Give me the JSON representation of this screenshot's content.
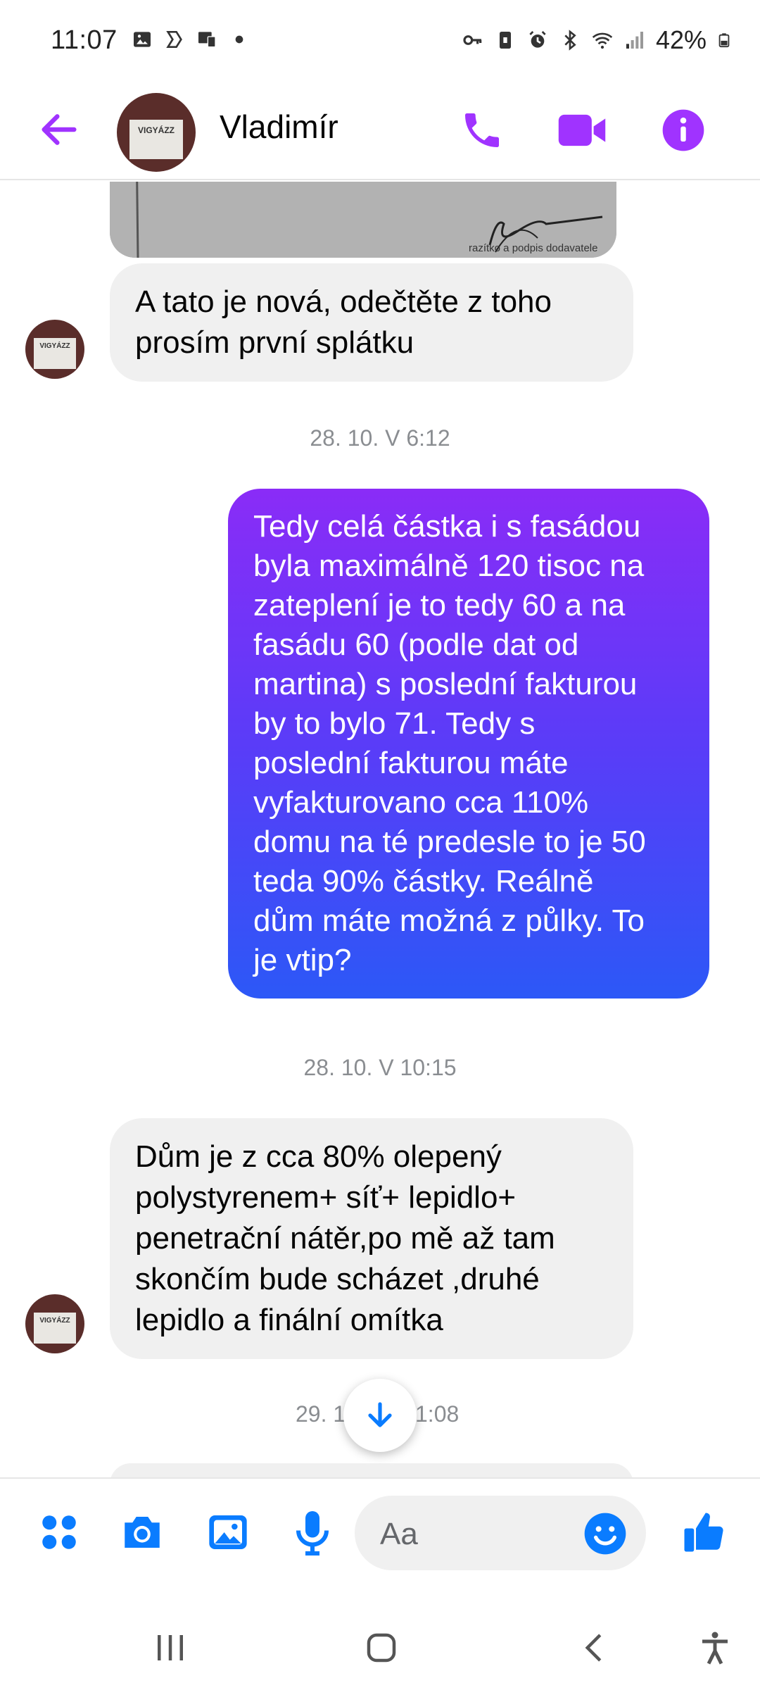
{
  "status_bar": {
    "time": "11:07",
    "battery": "42%",
    "left_icons": [
      "gallery-icon",
      "location-icon",
      "cast-icon",
      "dot-icon"
    ],
    "right_icons": [
      "key-icon",
      "lock-icon",
      "alarm-icon",
      "bluetooth-icon",
      "wifi-icon",
      "signal-icon",
      "battery-icon"
    ]
  },
  "header": {
    "contact_name": "Vladimír",
    "avatar_text": "VIGYÁZZ",
    "accent_color": "#a033ff"
  },
  "messages": [
    {
      "type": "image",
      "direction": "incoming",
      "caption": "razítko a podpis dodavatele"
    },
    {
      "type": "text",
      "direction": "incoming",
      "lines": [
        "A tato je nová, odečtěte z toho",
        "prosím první splátku"
      ]
    },
    {
      "type": "timestamp",
      "text": "28. 10. V 6:12"
    },
    {
      "type": "text",
      "direction": "outgoing",
      "lines": [
        "Tedy celá částka i s fasádou",
        "byla maximálně 120 tisoc na",
        "zateplení je to tedy 60 a na",
        "fasádu 60 (podle dat od",
        "martina) s poslední fakturou",
        "by to bylo 71. Tedy s",
        "poslední fakturou máte",
        "vyfakturovano cca 110%",
        "domu na té predesle to je 50",
        "teda 90% částky. Reálně",
        "dům máte možná z půlky. To",
        "je vtip?"
      ]
    },
    {
      "type": "timestamp",
      "text": "28. 10. V 10:15"
    },
    {
      "type": "text",
      "direction": "incoming",
      "lines": [
        "Dům je z cca 80% olepený",
        "polystyrenem+ síť+ lepidlo+",
        "penetrační nátěr,po mě až tam",
        "skončím bude scházet ,druhé",
        "lepidlo a finální omítka"
      ]
    },
    {
      "type": "timestamp",
      "text_left": "29. 1",
      "text_right": "1:08"
    }
  ],
  "composer": {
    "placeholder": "Aa",
    "icons": [
      "apps-icon",
      "camera-icon",
      "gallery-icon",
      "microphone-icon",
      "emoji-icon",
      "thumbs-up-icon"
    ],
    "icon_color": "#0a7cff"
  },
  "nav": {
    "icons": [
      "recent-apps-icon",
      "home-icon",
      "back-icon",
      "accessibility-icon"
    ]
  }
}
